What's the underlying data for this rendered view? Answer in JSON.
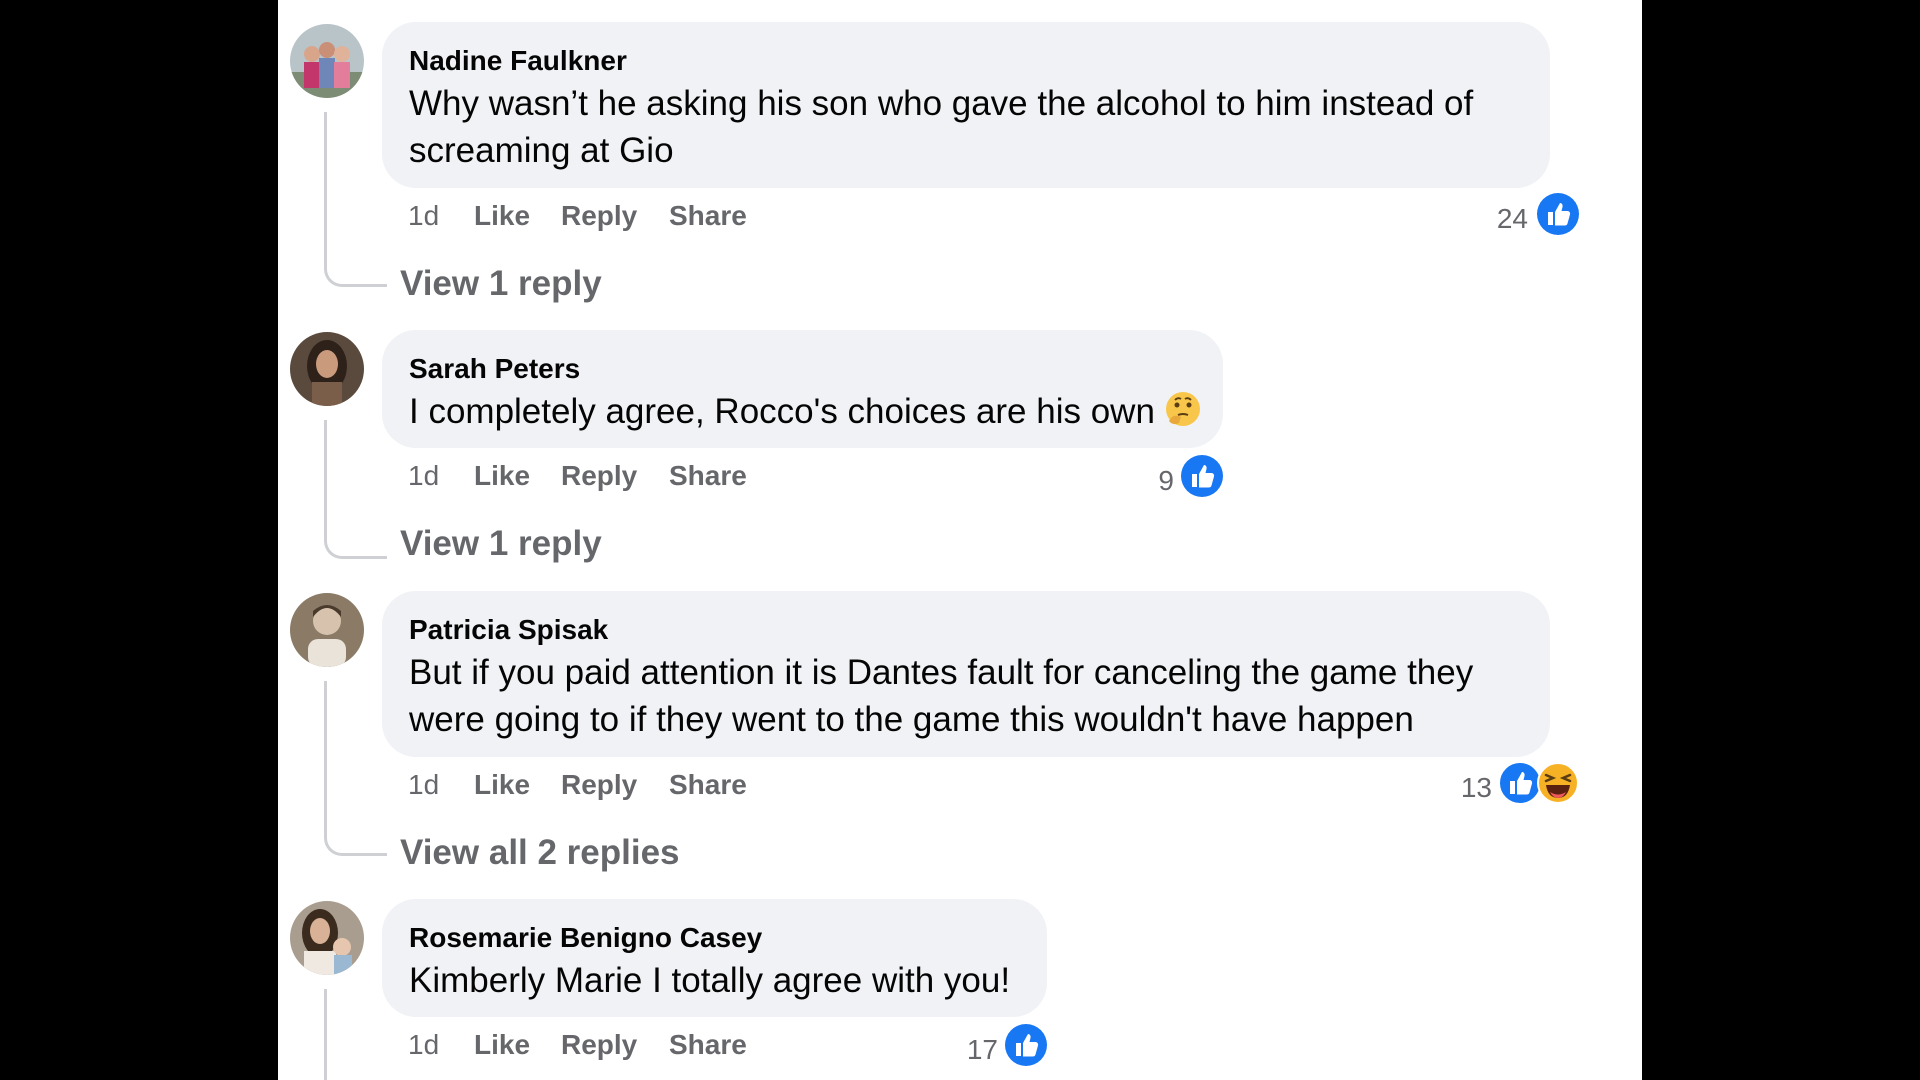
{
  "comments": [
    {
      "author": "Nadine Faulkner",
      "text": "Why wasn’t he asking his son who gave the alcohol to him instead of screaming at Gio",
      "time": "1d",
      "like_label": "Like",
      "reply_label": "Reply",
      "share_label": "Share",
      "reaction_count": "24",
      "reactions": [
        "like"
      ],
      "view_replies": "View 1 reply"
    },
    {
      "author": "Sarah Peters",
      "text": "I completely agree, Rocco's choices are his own",
      "text_emoji": "thinking-face-emoji",
      "time": "1d",
      "like_label": "Like",
      "reply_label": "Reply",
      "share_label": "Share",
      "reaction_count": "9",
      "reactions": [
        "like"
      ],
      "view_replies": "View 1 reply"
    },
    {
      "author": "Patricia Spisak",
      "text": "But if you paid attention it is Dantes fault for canceling the game they were going to if they went to the game this wouldn't have happen",
      "time": "1d",
      "like_label": "Like",
      "reply_label": "Reply",
      "share_label": "Share",
      "reaction_count": "13",
      "reactions": [
        "like",
        "haha"
      ],
      "view_replies": "View all 2 replies"
    },
    {
      "author": "Rosemarie Benigno Casey",
      "text": "Kimberly Marie I totally agree with you!",
      "time": "1d",
      "like_label": "Like",
      "reply_label": "Reply",
      "share_label": "Share",
      "reaction_count": "17",
      "reactions": [
        "like"
      ]
    }
  ],
  "colors": {
    "bubble": "#f0f2f5",
    "secondary_text": "#65676b",
    "like_blue": "#1877f2",
    "haha_yellow": "#f7b125"
  }
}
